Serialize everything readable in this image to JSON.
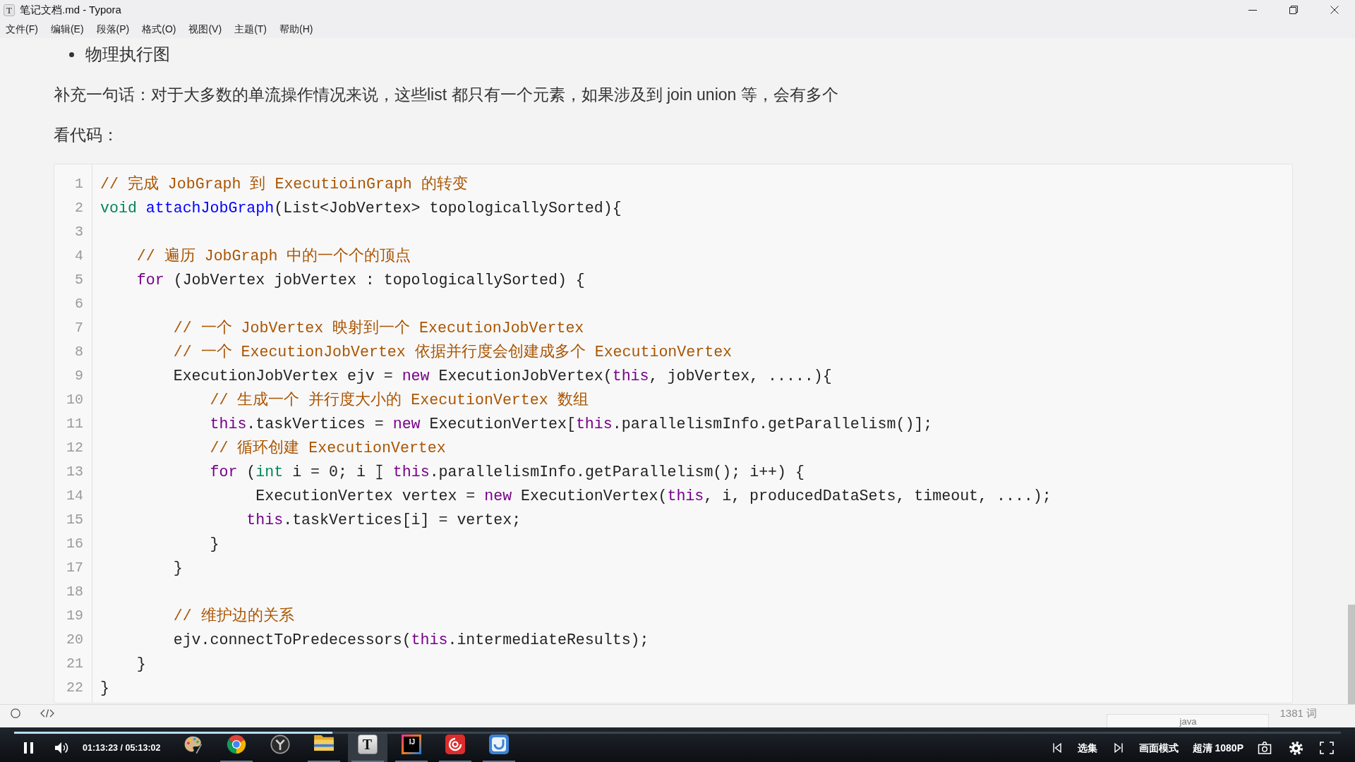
{
  "window": {
    "icon_letter": "T",
    "title": "笔记文档.md - Typora"
  },
  "menu": [
    "文件(F)",
    "编辑(E)",
    "段落(P)",
    "格式(O)",
    "视图(V)",
    "主题(T)",
    "帮助(H)"
  ],
  "document": {
    "blocks": [
      {
        "kind": "bullet",
        "text": "物理执行图"
      },
      {
        "kind": "paragraph",
        "text": "补充一句话：对于大多数的单流操作情况来说，这些list 都只有一个元素，如果涉及到 join union 等，会有多个"
      },
      {
        "kind": "paragraph",
        "text": "看代码："
      },
      {
        "kind": "code",
        "language": "java",
        "lines": [
          {
            "number": "1",
            "tokens": [
              {
                "kind": "comment",
                "text": "// 完成 JobGraph 到 ExecutioinGraph 的转变"
              }
            ]
          },
          {
            "number": "2",
            "tokens": [
              {
                "kind": "type",
                "text": "void "
              },
              {
                "kind": "def",
                "text": "attachJobGraph"
              },
              {
                "kind": "plain",
                "text": "(List<JobVertex> topologicallySorted){"
              }
            ]
          },
          {
            "number": "3"
          },
          {
            "number": "4",
            "tokens": [
              {
                "kind": "comment",
                "text": "    // 遍历 JobGraph 中的一个个的顶点"
              }
            ]
          },
          {
            "number": "5",
            "tokens": [
              {
                "kind": "keyword",
                "text": "    for"
              },
              {
                "kind": "plain",
                "text": " (JobVertex jobVertex : topologicallySorted) {"
              }
            ]
          },
          {
            "number": "6"
          },
          {
            "number": "7",
            "tokens": [
              {
                "kind": "comment",
                "text": "        // 一个 JobVertex 映射到一个 ExecutionJobVertex"
              }
            ]
          },
          {
            "number": "8",
            "tokens": [
              {
                "kind": "comment",
                "text": "        // 一个 ExecutionJobVertex 依据并行度会创建成多个 ExecutionVertex"
              }
            ]
          },
          {
            "number": "9",
            "tokens": [
              {
                "kind": "plain",
                "text": "        ExecutionJobVertex ejv = "
              },
              {
                "kind": "keyword",
                "text": "new"
              },
              {
                "kind": "plain",
                "text": " ExecutionJobVertex("
              },
              {
                "kind": "keyword",
                "text": "this"
              },
              {
                "kind": "plain",
                "text": ", jobVertex, .....){"
              }
            ]
          },
          {
            "number": "10",
            "tokens": [
              {
                "kind": "comment",
                "text": "            // 生成一个 并行度大小的 ExecutionVertex 数组"
              }
            ]
          },
          {
            "number": "11",
            "tokens": [
              {
                "kind": "keyword",
                "text": "            this"
              },
              {
                "kind": "plain",
                "text": ".taskVertices = "
              },
              {
                "kind": "keyword",
                "text": "new"
              },
              {
                "kind": "plain",
                "text": " ExecutionVertex["
              },
              {
                "kind": "keyword",
                "text": "this"
              },
              {
                "kind": "plain",
                "text": ".parallelismInfo.getParallelism()];"
              }
            ]
          },
          {
            "number": "12",
            "tokens": [
              {
                "kind": "comment",
                "text": "            // 循环创建 ExecutionVertex"
              }
            ]
          },
          {
            "number": "13",
            "tokens": [
              {
                "kind": "keyword",
                "text": "            for"
              },
              {
                "kind": "plain",
                "text": " ("
              },
              {
                "kind": "type",
                "text": "int"
              },
              {
                "kind": "plain",
                "text": " i = 0; i "
              },
              {
                "kind": "pointer"
              },
              {
                "kind": "keyword",
                "text": " this"
              },
              {
                "kind": "plain",
                "text": ".parallelismInfo.getParallelism(); i++) {"
              }
            ]
          },
          {
            "number": "14",
            "tokens": [
              {
                "kind": "plain",
                "text": "                 ExecutionVertex vertex = "
              },
              {
                "kind": "keyword",
                "text": "new"
              },
              {
                "kind": "plain",
                "text": " ExecutionVertex("
              },
              {
                "kind": "keyword",
                "text": "this"
              },
              {
                "kind": "plain",
                "text": ", i, producedDataSets, timeout, ....);"
              }
            ]
          },
          {
            "number": "15",
            "tokens": [
              {
                "kind": "keyword",
                "text": "                this"
              },
              {
                "kind": "plain",
                "text": ".taskVertices[i] = vertex;"
              }
            ]
          },
          {
            "number": "16",
            "tokens": [
              {
                "kind": "plain",
                "text": "            }"
              }
            ]
          },
          {
            "number": "17",
            "tokens": [
              {
                "kind": "plain",
                "text": "        }"
              }
            ]
          },
          {
            "number": "18"
          },
          {
            "number": "19",
            "tokens": [
              {
                "kind": "comment",
                "text": "        // 维护边的关系"
              }
            ]
          },
          {
            "number": "20",
            "tokens": [
              {
                "kind": "plain",
                "text": "        ejv.connectToPredecessors("
              },
              {
                "kind": "keyword",
                "text": "this"
              },
              {
                "kind": "plain",
                "text": ".intermediateResults);"
              }
            ]
          },
          {
            "number": "21",
            "tokens": [
              {
                "kind": "plain",
                "text": "    }"
              }
            ]
          },
          {
            "number": "22",
            "tokens": [
              {
                "kind": "plain",
                "text": "}"
              }
            ]
          }
        ]
      }
    ]
  },
  "status_bar": {
    "word_count": "1381 词"
  },
  "player": {
    "level": 0.24,
    "time": "01:13:23 / 05:13:02",
    "episodes": "选集",
    "picture_mode": "画面模式",
    "quality": "超清 1080P"
  },
  "taskbar": {
    "apps": [
      {
        "kind": "paint",
        "selected": false,
        "running": false
      },
      {
        "kind": "chrome",
        "selected": false,
        "running": true
      },
      {
        "kind": "hub",
        "selected": false,
        "running": false
      },
      {
        "kind": "folder",
        "selected": false,
        "running": true
      },
      {
        "kind": "typora",
        "glyph": "T",
        "selected": true,
        "running": true
      },
      {
        "kind": "intellij",
        "glyph": "IJ",
        "selected": false,
        "running": true
      },
      {
        "kind": "music",
        "selected": false,
        "running": true
      },
      {
        "kind": "player",
        "selected": false,
        "running": true
      }
    ]
  }
}
